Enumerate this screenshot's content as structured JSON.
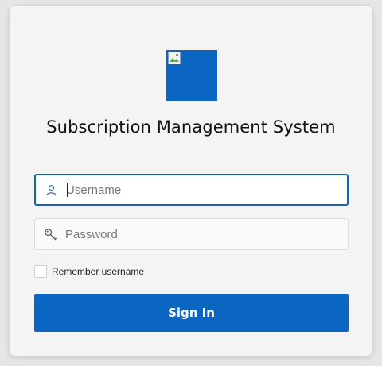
{
  "app": {
    "title": "Subscription Management System",
    "accent_color": "#0b66c3"
  },
  "logo": {
    "icon": "broken-image-icon"
  },
  "form": {
    "username": {
      "value": "",
      "placeholder": "Username",
      "icon": "user-icon"
    },
    "password": {
      "value": "",
      "placeholder": "Password",
      "icon": "key-icon"
    },
    "remember": {
      "label": "Remember username",
      "checked": false
    },
    "submit_label": "Sign In"
  }
}
